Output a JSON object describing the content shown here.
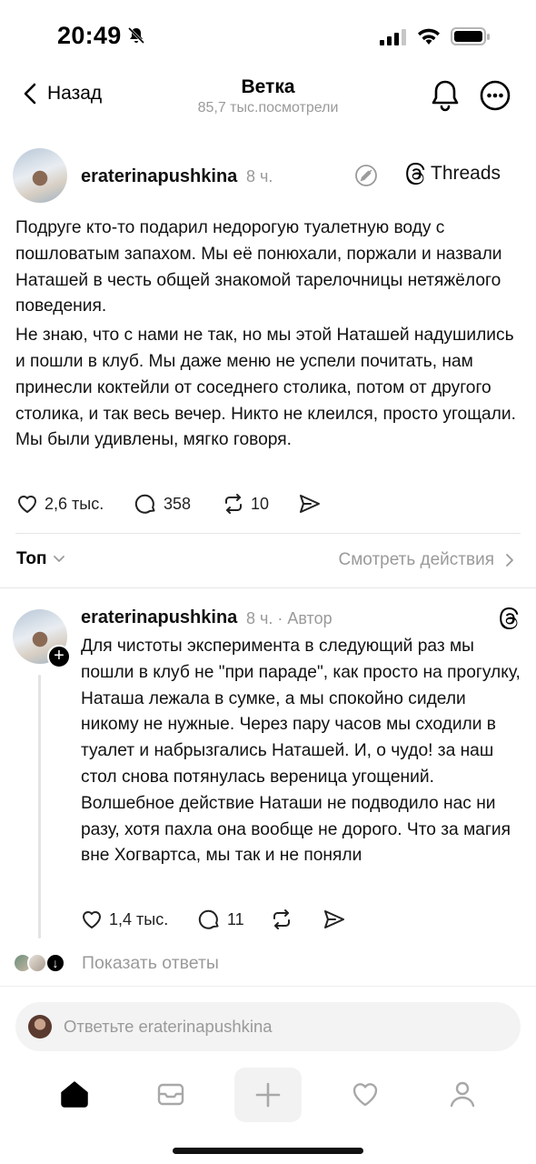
{
  "status_bar": {
    "time": "20:49",
    "icons": [
      "bell-off-icon",
      "signal-icon",
      "wifi-icon",
      "battery-icon"
    ]
  },
  "header": {
    "back_label": "Назад",
    "title": "Ветка",
    "subtitle": "85,7 тыс.посмотрели",
    "icons": [
      "chevron-left-icon",
      "bell-icon",
      "more-icon"
    ]
  },
  "post": {
    "username": "eraterinapushkina",
    "time": "8 ч.",
    "threads_label": "Threads",
    "paragraphs": [
      "Подруге кто-то подарил недорогую туалетную воду с пошловатым запахом. Мы её понюхали, поржали и назвали Наташей в честь общей знакомой тарелочницы нетяжёлого поведения.",
      "Не знаю, что с нами не так, но мы этой Наташей надушились и пошли в клуб. Мы даже меню не успели почитать, нам принесли коктейли от соседнего столика, потом от другого столика, и так весь вечер. Никто не клеился, просто угощали. Мы были удивлены, мягко говоря."
    ],
    "likes": "2,6 тыс.",
    "comments": "358",
    "reposts": "10"
  },
  "sort": {
    "label": "Топ",
    "view_activity": "Смотреть действия"
  },
  "reply": {
    "username": "eraterinapushkina",
    "meta": "8 ч. · Автор",
    "text": "Для чистоты эксперимента в следующий раз мы пошли в клуб не \"при параде\", как просто на прогулку, Наташа лежала в сумке, а мы спокойно сидели никому не нужные. Через пару часов мы сходили в туалет и набрызгались Наташей. И, о чудо! за наш стол снова потянулась вереница угощений. Волшебное действие Наташи не подводило нас ни разу, хотя пахла она вообще не дорого. Что за магия вне Хогвартса, мы так и не поняли",
    "likes": "1,4 тыс.",
    "comments": "11"
  },
  "show_replies_label": "Показать ответы",
  "reply_input": {
    "placeholder": "Ответьте eraterinapushkina"
  },
  "bottom_nav": [
    "home-icon",
    "inbox-icon",
    "plus-icon",
    "heart-icon",
    "profile-icon"
  ]
}
